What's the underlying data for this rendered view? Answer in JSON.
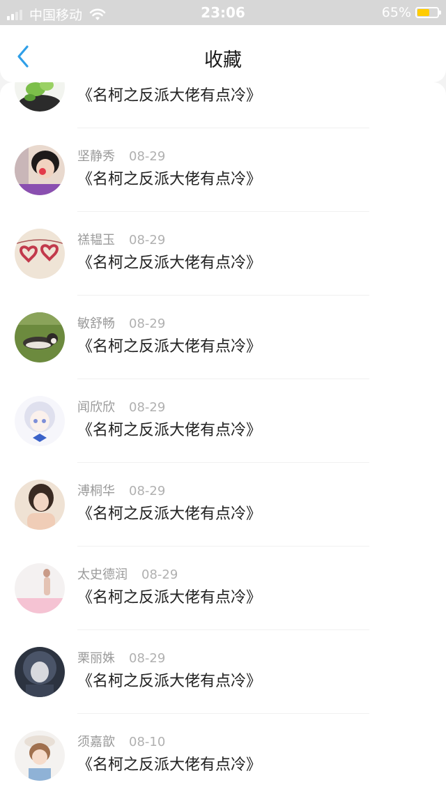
{
  "status_bar": {
    "carrier": "中国移动",
    "time": "23:06",
    "battery": "65%",
    "battery_level": 0.65
  },
  "nav": {
    "title": "收藏"
  },
  "items": [
    {
      "name": "",
      "date": "",
      "title": "《名柯之反派大佬有点冷》"
    },
    {
      "name": "坚静秀",
      "date": "08-29",
      "title": "《名柯之反派大佬有点冷》"
    },
    {
      "name": "禚韫玉",
      "date": "08-29",
      "title": "《名柯之反派大佬有点冷》"
    },
    {
      "name": "敏舒畅",
      "date": "08-29",
      "title": "《名柯之反派大佬有点冷》"
    },
    {
      "name": "闻欣欣",
      "date": "08-29",
      "title": "《名柯之反派大佬有点冷》"
    },
    {
      "name": "溥桐华",
      "date": "08-29",
      "title": "《名柯之反派大佬有点冷》"
    },
    {
      "name": "太史德润",
      "date": "08-29",
      "title": "《名柯之反派大佬有点冷》"
    },
    {
      "name": "栗丽姝",
      "date": "08-29",
      "title": "《名柯之反派大佬有点冷》"
    },
    {
      "name": "须嘉歆",
      "date": "08-10",
      "title": "《名柯之反派大佬有点冷》"
    }
  ],
  "colors": {
    "accent": "#2f9fe8",
    "status_bar_bg": "#d7d7d7",
    "battery_fill": "#ffcc00"
  }
}
